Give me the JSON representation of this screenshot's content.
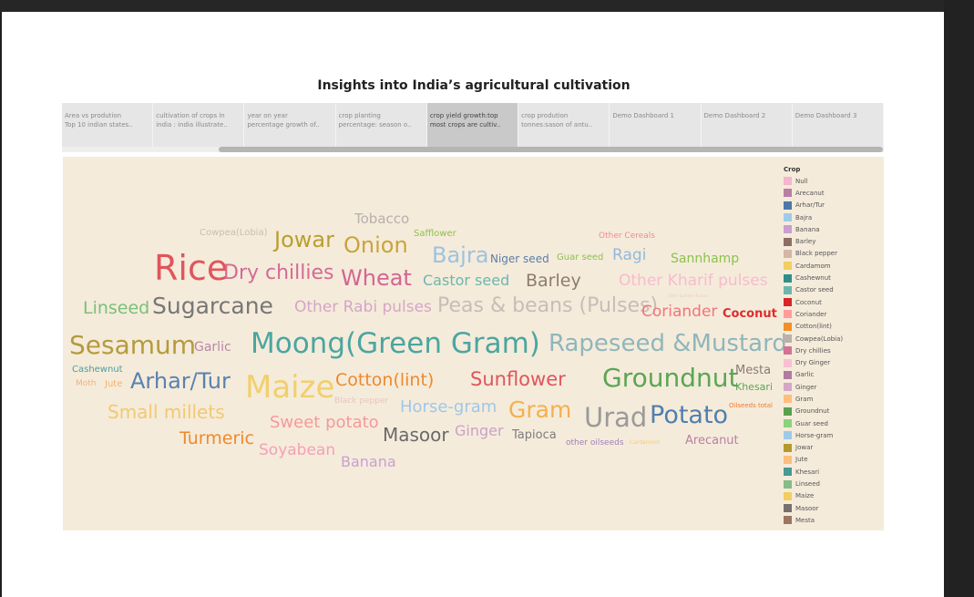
{
  "dashboard": {
    "title": "Insights into India’s agricultural cultivation",
    "tabs": [
      {
        "line1": "Area vs prodution",
        "line2": "Top 10 indian states..",
        "active": false
      },
      {
        "line1": "cultivation of crops in",
        "line2": "india : india illustrate..",
        "active": false
      },
      {
        "line1": "year on year",
        "line2": "percentage growth of..",
        "active": false
      },
      {
        "line1": "crop planting",
        "line2": "percentage: season o..",
        "active": false
      },
      {
        "line1": "crop yield growth:top",
        "line2": "most crops are cultiv..",
        "active": true
      },
      {
        "line1": "crop prodution",
        "line2": "tonnes:sason of antu..",
        "active": false
      },
      {
        "line1": "Demo Dashboard 1",
        "line2": "",
        "active": false
      },
      {
        "line1": "Demo Dashboard 2",
        "line2": "",
        "active": false
      },
      {
        "line1": "Demo Dashboard 3",
        "line2": "",
        "active": false
      }
    ]
  },
  "word_cloud": {
    "words": [
      {
        "text": "Tobacco",
        "color": "#b8b0ac"
      },
      {
        "text": "Cowpea(Lobia)",
        "color": "#c9bdb4"
      },
      {
        "text": "Jowar",
        "color": "#b9a02d"
      },
      {
        "text": "Onion",
        "color": "#c9a43a"
      },
      {
        "text": "Safflower",
        "color": "#8cc24a"
      },
      {
        "text": "Other Cereals",
        "color": "#f08a96"
      },
      {
        "text": "Bajra",
        "color": "#9cc3e0"
      },
      {
        "text": "Niger seed",
        "color": "#5a7fa6"
      },
      {
        "text": "Guar seed",
        "color": "#8cc24a"
      },
      {
        "text": "Ragi",
        "color": "#8fbadc"
      },
      {
        "text": "Sannhamp",
        "color": "#8cc24a"
      },
      {
        "text": "Rice",
        "color": "#e0555c"
      },
      {
        "text": "Dry chillies",
        "color": "#d46a96"
      },
      {
        "text": "Wheat",
        "color": "#d36593"
      },
      {
        "text": "Castor seed",
        "color": "#6bb7ae"
      },
      {
        "text": "Barley",
        "color": "#8d7b71"
      },
      {
        "text": "Other Kharif pulses",
        "color": "#f6bccc"
      },
      {
        "text": "Linseed",
        "color": "#79c07a"
      },
      {
        "text": "Sugarcane",
        "color": "#777777"
      },
      {
        "text": "Other Rabi pulses",
        "color": "#d5a6c6"
      },
      {
        "text": "Peas & beans (Pulses)",
        "color": "#c8bdb7"
      },
      {
        "text": "Other Summer Pulses",
        "color": "#e6cfc4"
      },
      {
        "text": "Coriander",
        "color": "#f2757a"
      },
      {
        "text": "Coconut",
        "color": "#d92f2f"
      },
      {
        "text": "Sesamum",
        "color": "#b49b3e"
      },
      {
        "text": "Garlic",
        "color": "#b787a6"
      },
      {
        "text": "Moong(Green Gram)",
        "color": "#4aa6a0"
      },
      {
        "text": "Rapeseed &Mustard",
        "color": "#8fb6bb"
      },
      {
        "text": "Cashewnut",
        "color": "#4e9e9a"
      },
      {
        "text": "Moth",
        "color": "#f3b07a"
      },
      {
        "text": "Jute",
        "color": "#f4b26a"
      },
      {
        "text": "Arhar/Tur",
        "color": "#5a82ad"
      },
      {
        "text": "Maize",
        "color": "#f1cf6d"
      },
      {
        "text": "Cotton(lint)",
        "color": "#ed8a2c"
      },
      {
        "text": "Sunflower",
        "color": "#e0555c"
      },
      {
        "text": "Groundnut",
        "color": "#5aa653"
      },
      {
        "text": "Mesta",
        "color": "#8a7b75"
      },
      {
        "text": "Khesari",
        "color": "#5aa653"
      },
      {
        "text": "Small millets",
        "color": "#f1c96f"
      },
      {
        "text": "Black pepper",
        "color": "#e3c7c0"
      },
      {
        "text": "Horse-gram",
        "color": "#9ec7ea"
      },
      {
        "text": "Gram",
        "color": "#f5b04d"
      },
      {
        "text": "Urad",
        "color": "#9a9a9a"
      },
      {
        "text": "Potato",
        "color": "#4f7fae"
      },
      {
        "text": "Oilseeds total",
        "color": "#f07a2a"
      },
      {
        "text": "Sweet potato",
        "color": "#f59a9a"
      },
      {
        "text": "Masoor",
        "color": "#6a6a6a"
      },
      {
        "text": "Ginger",
        "color": "#c9a2c8"
      },
      {
        "text": "Tapioca",
        "color": "#7d7d7d"
      },
      {
        "text": "other oilseeds",
        "color": "#a27fb5"
      },
      {
        "text": "Cardamom",
        "color": "#f1cf6d"
      },
      {
        "text": "Arecanut",
        "color": "#b87fa2"
      },
      {
        "text": "Turmeric",
        "color": "#ed8a2c"
      },
      {
        "text": "Soyabean",
        "color": "#f4a0b8"
      },
      {
        "text": "Banana",
        "color": "#c9a0d0"
      }
    ]
  },
  "legend": {
    "title": "Crop",
    "items": [
      {
        "label": "Null",
        "color": "#f6b4cf"
      },
      {
        "label": "Arecanut",
        "color": "#b87fa2"
      },
      {
        "label": "Arhar/Tur",
        "color": "#4e79a7"
      },
      {
        "label": "Bajra",
        "color": "#a0cbe8"
      },
      {
        "label": "Banana",
        "color": "#c9a0d0"
      },
      {
        "label": "Barley",
        "color": "#8d6e63"
      },
      {
        "label": "Black pepper",
        "color": "#d7b5a6"
      },
      {
        "label": "Cardamom",
        "color": "#f1ce63"
      },
      {
        "label": "Cashewnut",
        "color": "#2f8f88"
      },
      {
        "label": "Castor seed",
        "color": "#6bb7ae"
      },
      {
        "label": "Coconut",
        "color": "#d62728"
      },
      {
        "label": "Coriander",
        "color": "#ff9d9a"
      },
      {
        "label": "Cotton(lint)",
        "color": "#f28e2b"
      },
      {
        "label": "Cowpea(Lobia)",
        "color": "#bab0ac"
      },
      {
        "label": "Dry chillies",
        "color": "#d37295"
      },
      {
        "label": "Dry Ginger",
        "color": "#fabfd2"
      },
      {
        "label": "Garlic",
        "color": "#b07aa1"
      },
      {
        "label": "Ginger",
        "color": "#d4a6c8"
      },
      {
        "label": "Gram",
        "color": "#ffbe7d"
      },
      {
        "label": "Groundnut",
        "color": "#59a14f"
      },
      {
        "label": "Guar seed",
        "color": "#8cd17d"
      },
      {
        "label": "Horse-gram",
        "color": "#9ecae9"
      },
      {
        "label": "Jowar",
        "color": "#b6992d"
      },
      {
        "label": "Jute",
        "color": "#ffbe7d"
      },
      {
        "label": "Khesari",
        "color": "#499894"
      },
      {
        "label": "Linseed",
        "color": "#86bc86"
      },
      {
        "label": "Maize",
        "color": "#f1ce63"
      },
      {
        "label": "Masoor",
        "color": "#79706e"
      },
      {
        "label": "Mesta",
        "color": "#9d7660"
      }
    ]
  }
}
